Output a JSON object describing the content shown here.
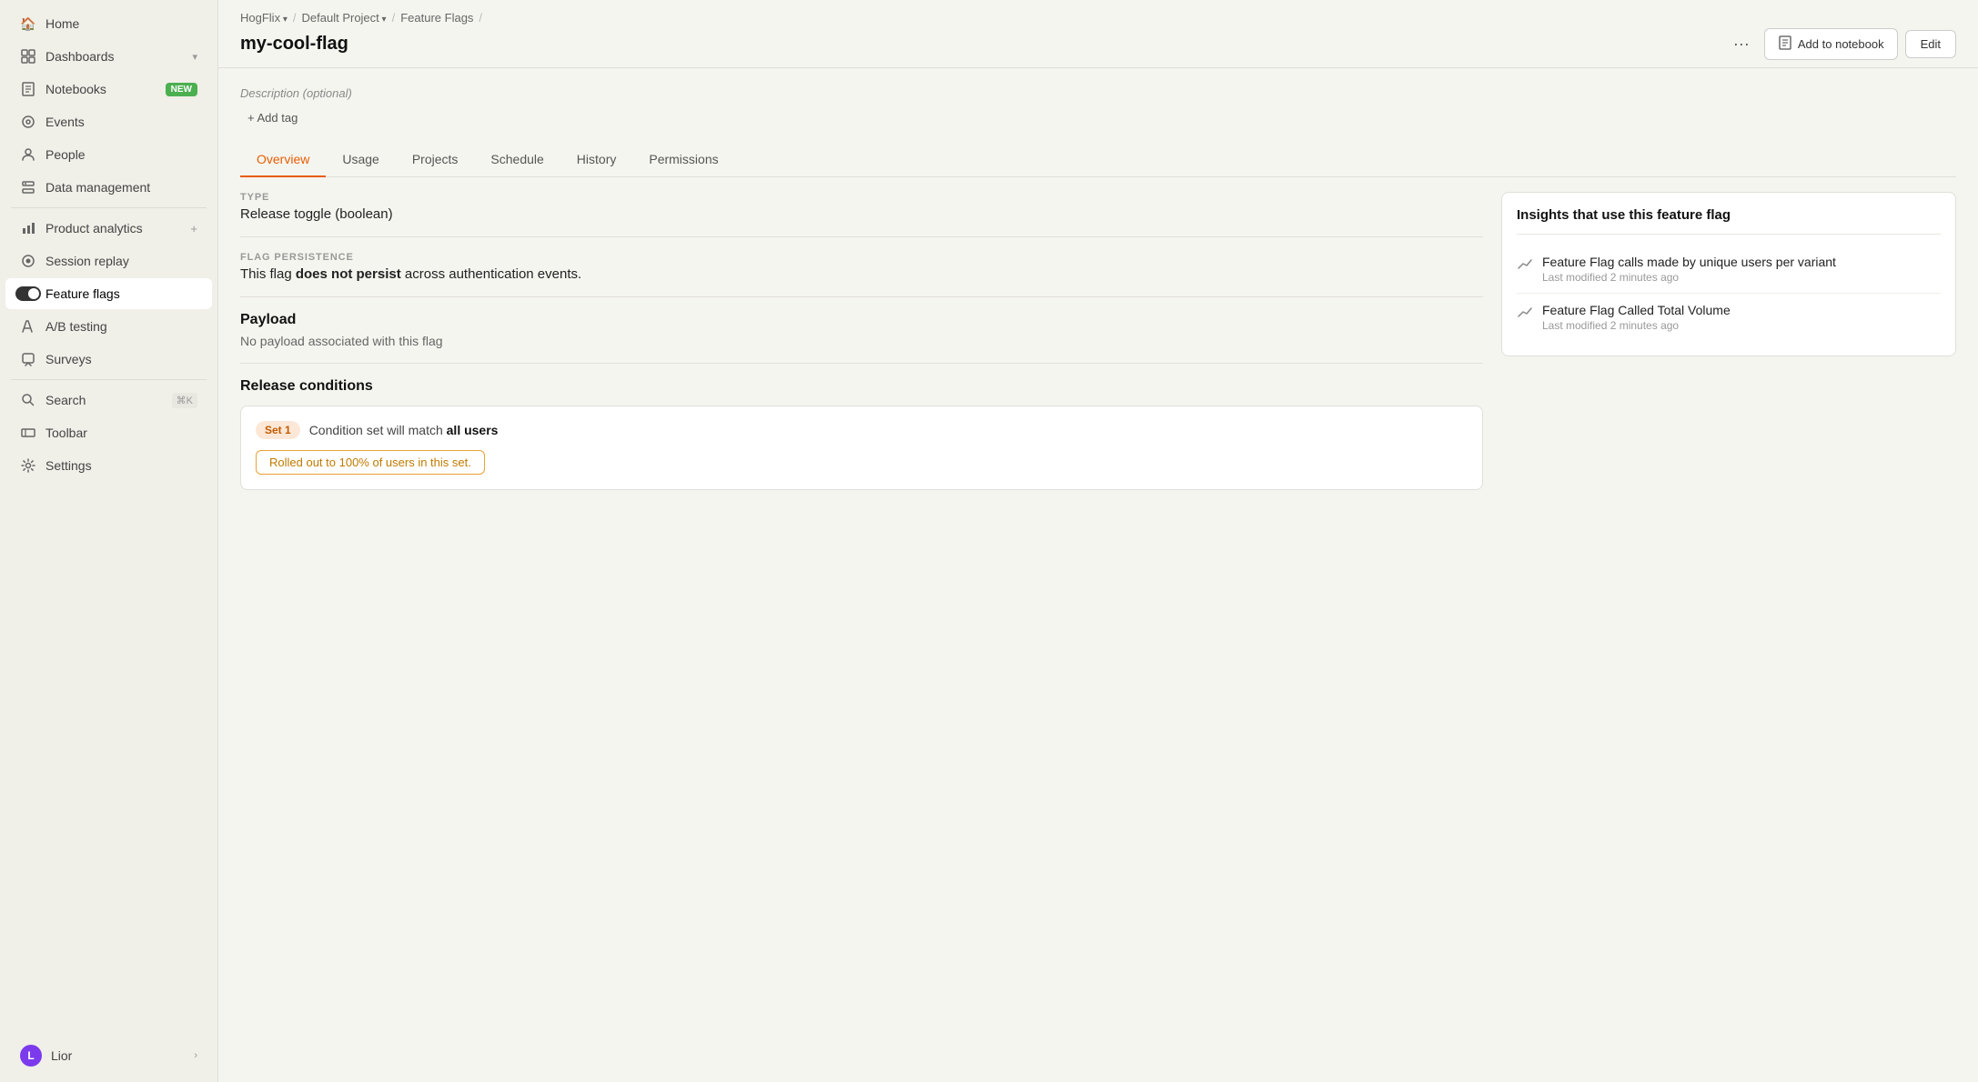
{
  "sidebar": {
    "items": [
      {
        "id": "home",
        "label": "Home",
        "icon": "🏠",
        "active": false
      },
      {
        "id": "dashboards",
        "label": "Dashboards",
        "icon": "▦",
        "active": false,
        "chevron": "▾"
      },
      {
        "id": "notebooks",
        "label": "Notebooks",
        "icon": "☰",
        "active": false,
        "badge": "NEW"
      },
      {
        "id": "events",
        "label": "Events",
        "icon": "◎",
        "active": false
      },
      {
        "id": "people",
        "label": "People",
        "icon": "👤",
        "active": false
      },
      {
        "id": "data-management",
        "label": "Data management",
        "icon": "🗄",
        "active": false
      },
      {
        "id": "product-analytics",
        "label": "Product analytics",
        "icon": "📊",
        "active": false,
        "plus": true
      },
      {
        "id": "session-replay",
        "label": "Session replay",
        "icon": "⏺",
        "active": false
      },
      {
        "id": "feature-flags",
        "label": "Feature flags",
        "icon": "toggle",
        "active": true
      },
      {
        "id": "ab-testing",
        "label": "A/B testing",
        "icon": "✂",
        "active": false
      },
      {
        "id": "surveys",
        "label": "Surveys",
        "icon": "💬",
        "active": false
      },
      {
        "id": "search",
        "label": "Search",
        "icon": "🔍",
        "active": false,
        "shortcut": "⌘K"
      },
      {
        "id": "toolbar",
        "label": "Toolbar",
        "icon": "☰",
        "active": false
      },
      {
        "id": "settings",
        "label": "Settings",
        "icon": "⚙",
        "active": false
      }
    ],
    "user": {
      "label": "Lior",
      "initial": "L"
    }
  },
  "breadcrumb": {
    "items": [
      {
        "label": "HogFlix",
        "hasArrow": true
      },
      {
        "label": "Default Project",
        "hasArrow": true
      },
      {
        "label": "Feature Flags",
        "hasArrow": false
      }
    ]
  },
  "header": {
    "title": "my-cool-flag",
    "more_label": "···",
    "add_notebook_label": "Add to notebook",
    "edit_label": "Edit"
  },
  "description": {
    "label": "Description (optional)",
    "add_tag_label": "+ Add tag"
  },
  "tabs": [
    {
      "id": "overview",
      "label": "Overview",
      "active": true
    },
    {
      "id": "usage",
      "label": "Usage",
      "active": false
    },
    {
      "id": "projects",
      "label": "Projects",
      "active": false
    },
    {
      "id": "schedule",
      "label": "Schedule",
      "active": false
    },
    {
      "id": "history",
      "label": "History",
      "active": false
    },
    {
      "id": "permissions",
      "label": "Permissions",
      "active": false
    }
  ],
  "overview": {
    "type": {
      "label": "TYPE",
      "value": "Release toggle (boolean)"
    },
    "flag_persistence": {
      "label": "FLAG PERSISTENCE",
      "value_prefix": "This flag ",
      "value_bold": "does not persist",
      "value_suffix": " across authentication events."
    },
    "payload": {
      "title": "Payload",
      "empty_text": "No payload associated with this flag"
    },
    "release_conditions": {
      "title": "Release conditions",
      "condition_set": {
        "badge": "Set 1",
        "text_prefix": "Condition set will match ",
        "text_bold": "all users",
        "rollout_text": "Rolled out to 100% of users in this set."
      }
    }
  },
  "insights": {
    "title": "Insights that use this feature flag",
    "items": [
      {
        "name": "Feature Flag calls made by unique users per variant",
        "last_modified": "Last modified 2 minutes ago"
      },
      {
        "name": "Feature Flag Called Total Volume",
        "last_modified": "Last modified 2 minutes ago"
      }
    ]
  }
}
